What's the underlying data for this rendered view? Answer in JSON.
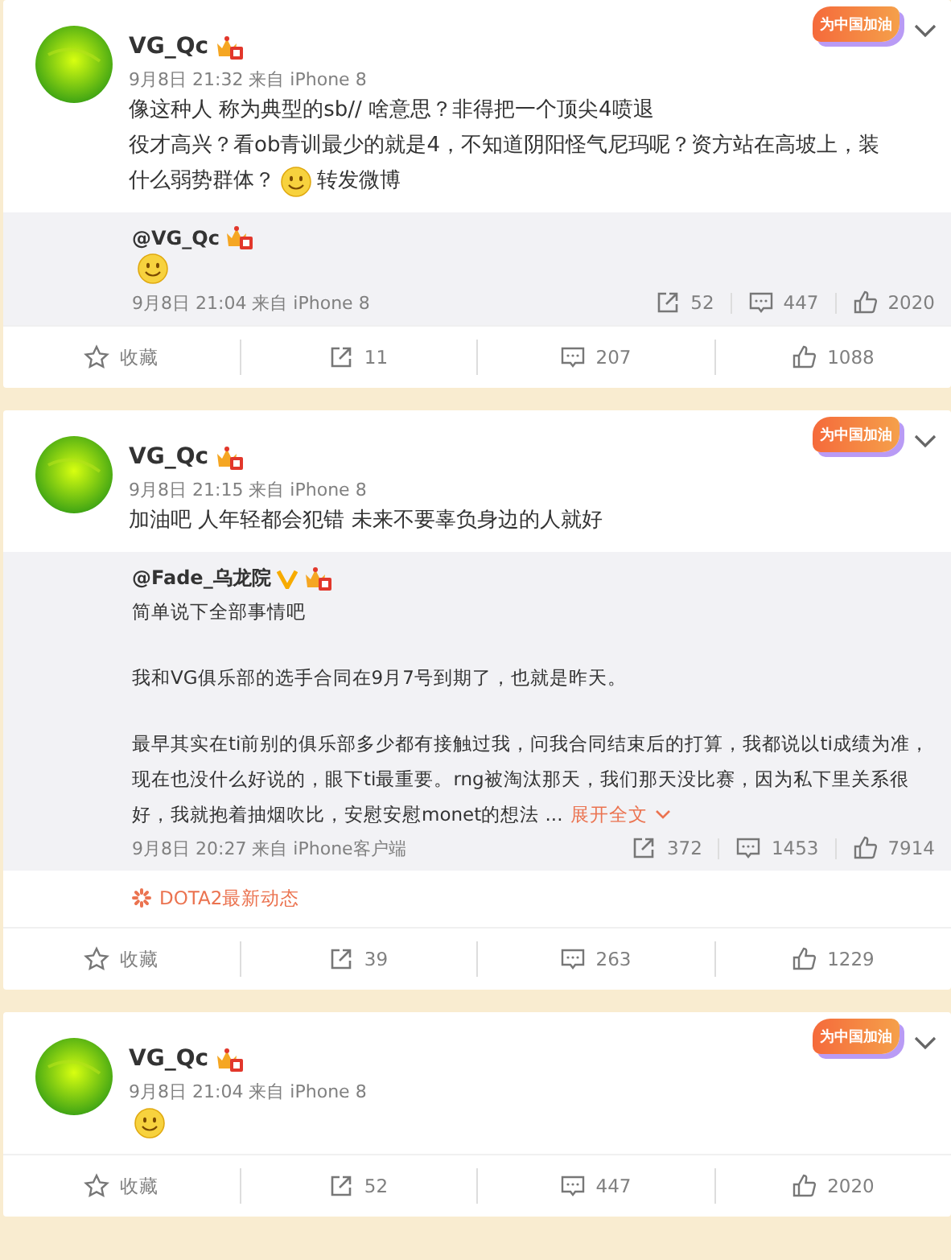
{
  "posts": [
    {
      "author": "VG_Qc",
      "badge": "为中国加油",
      "time": "9月8日 21:32 来自 iPhone 8",
      "lines": [
        [
          {
            "kind": "text",
            "text": "像这种人 称为典型的sb// 啥意思？非得把一个顶尖4喷退"
          }
        ],
        [
          {
            "kind": "text",
            "text": "役才高兴？看ob青训最少的就是4，不知道阴阳怪气尼玛呢？资方站在高坡上，装"
          }
        ],
        [
          {
            "kind": "text",
            "text": "什么弱势群体？"
          },
          {
            "kind": "emoji"
          },
          {
            "kind": "text",
            "text": "转发微博"
          }
        ]
      ],
      "retweet": {
        "author": "@VG_Qc",
        "verified": false,
        "paragraphs": [
          [
            [
              {
                "kind": "emoji"
              }
            ]
          ]
        ],
        "time": "9月8日 21:04 来自 iPhone 8",
        "counts": {
          "repost": "52",
          "comment": "447",
          "like": "2020"
        }
      },
      "actions": [
        {
          "kind": "favorite",
          "label": "收藏"
        },
        {
          "kind": "repost",
          "label": "11"
        },
        {
          "kind": "comment",
          "label": "207"
        },
        {
          "kind": "like",
          "label": "1088"
        }
      ]
    },
    {
      "author": "VG_Qc",
      "badge": "为中国加油",
      "time": "9月8日 21:15 来自 iPhone 8",
      "lines": [
        [
          {
            "kind": "text",
            "text": "加油吧  人年轻都会犯错 未来不要辜负身边的人就好"
          }
        ]
      ],
      "retweet": {
        "author": "@Fade_乌龙院",
        "verified": true,
        "paragraphs": [
          [
            [
              {
                "kind": "text",
                "text": "简单说下全部事情吧"
              }
            ]
          ],
          [
            [
              {
                "kind": "text",
                "text": "我和VG俱乐部的选手合同在9月7号到期了，也就是昨天。"
              }
            ]
          ],
          [
            [
              {
                "kind": "text",
                "text": "最早其实在ti前别的俱乐部多少都有接触过我，问我合同结束后的打算，我都说以ti成绩为准，"
              }
            ],
            [
              {
                "kind": "text",
                "text": "现在也没什么好说的，眼下ti最重要。rng被淘汰那天，我们那天没比赛，因为私下里关系很"
              }
            ],
            [
              {
                "kind": "text",
                "text": "好，我就抱着抽烟吹比，安慰安慰monet的想法 ..."
              },
              {
                "kind": "more",
                "text": "展开全文"
              }
            ]
          ]
        ],
        "time": "9月8日 20:27 来自 iPhone客户端",
        "counts": {
          "repost": "372",
          "comment": "1453",
          "like": "7914"
        }
      },
      "topic": "DOTA2最新动态",
      "actions": [
        {
          "kind": "favorite",
          "label": "收藏"
        },
        {
          "kind": "repost",
          "label": "39"
        },
        {
          "kind": "comment",
          "label": "263"
        },
        {
          "kind": "like",
          "label": "1229"
        }
      ]
    },
    {
      "author": "VG_Qc",
      "badge": "为中国加油",
      "time": "9月8日 21:04 来自 iPhone 8",
      "lines": [
        [
          {
            "kind": "emoji"
          }
        ]
      ],
      "actions": [
        {
          "kind": "favorite",
          "label": "收藏"
        },
        {
          "kind": "repost",
          "label": "52"
        },
        {
          "kind": "comment",
          "label": "447"
        },
        {
          "kind": "like",
          "label": "2020"
        }
      ]
    }
  ]
}
